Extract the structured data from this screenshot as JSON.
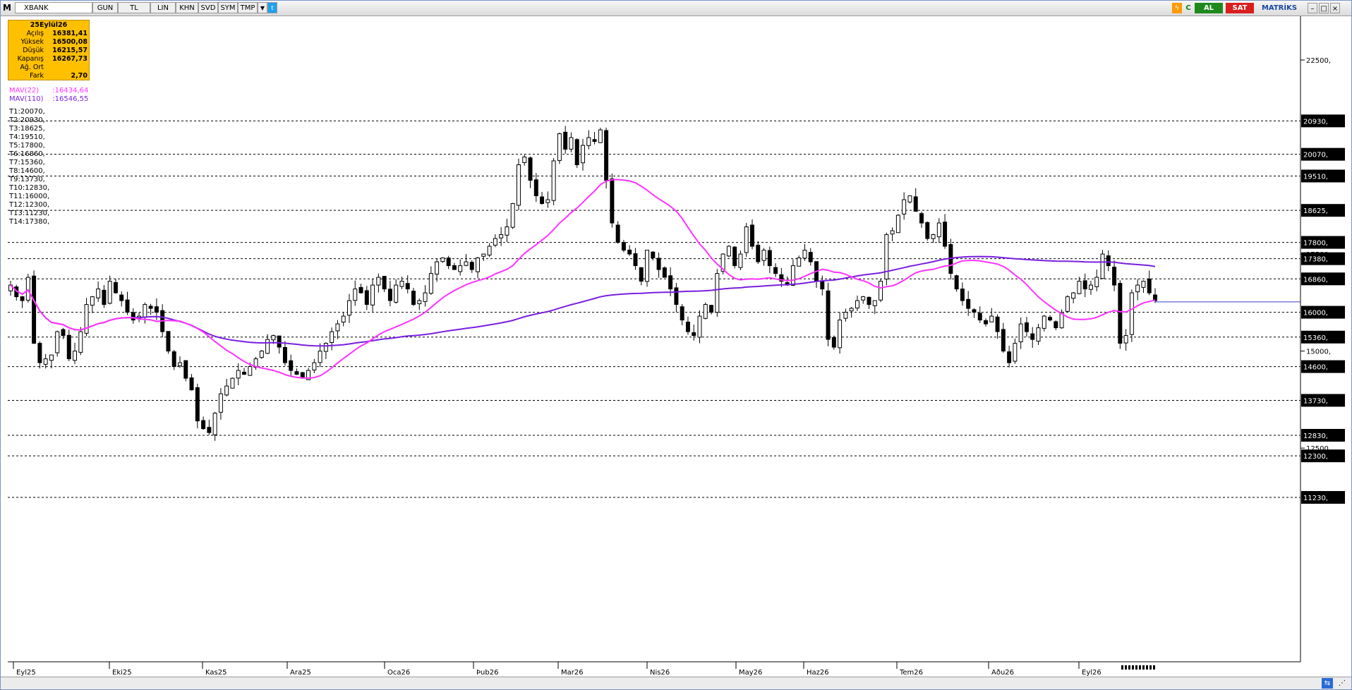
{
  "toolbar": {
    "symbol": "XBANK",
    "buttons": [
      "GUN",
      "TL",
      "LIN",
      "KHN",
      "SVD",
      "SYM",
      "TMP"
    ],
    "buy_label": "AL",
    "sell_label": "SAT",
    "brand": "MATRİKS"
  },
  "info_box": {
    "date": "25Eylül26",
    "rows": [
      {
        "label": "Açılış",
        "value": "16381,41"
      },
      {
        "label": "Yüksek",
        "value": "16500,08"
      },
      {
        "label": "Düşük",
        "value": "16215,57"
      },
      {
        "label": "Kapanış",
        "value": "16267,73"
      },
      {
        "label": "Ağ. Ort",
        "value": ""
      },
      {
        "label": "Fark",
        "value": "2,70"
      }
    ]
  },
  "legend": {
    "mav22": "MAV(22)      :16434,64",
    "mav110": "MAV(110)    :16546,55",
    "levels": [
      "T1:20070,",
      "T2:20930,",
      "T3:18625,",
      "T4:19510,",
      "T5:17800,",
      "T6:16860,",
      "T7:15360,",
      "T8:14600,",
      "T9:13730,",
      "T10:12830,",
      "T11:16000,",
      "T12:12300,",
      "T13:11230,",
      "T14:17380,"
    ]
  },
  "colors": {
    "mav22": "#ff33ff",
    "mav110": "#7a1fe0",
    "candle": "#000000",
    "level_label_bg": "#000000"
  },
  "chart_data": {
    "type": "candlestick",
    "symbol": "XBANK",
    "xlabels": [
      "Eyl25",
      "Eki25",
      "Kas25",
      "Ara25",
      "Oca26",
      "Þub26",
      "Mar26",
      "Nis26",
      "May26",
      "Haz26",
      "Tem26",
      "Aðu26",
      "Eyl26"
    ],
    "price_axis_ticks": [
      "22500,",
      "17500,",
      "15000,",
      "12500,"
    ],
    "levels": [
      20930,
      20070,
      19510,
      18625,
      17800,
      17380,
      16860,
      16000,
      15360,
      14600,
      13730,
      12830,
      12300,
      11230
    ],
    "level_labels": [
      "20930,",
      "20070,",
      "19510,",
      "18625,",
      "17800,",
      "17380,",
      "16860,",
      "16000,",
      "15360,",
      "14600,",
      "13730,",
      "12830,",
      "12300,",
      "11230,"
    ],
    "current_price": 16267.73,
    "ylim": [
      10000,
      23500
    ],
    "closes": [
      16700,
      16400,
      16300,
      16900,
      15200,
      14700,
      14800,
      14900,
      15500,
      15400,
      14800,
      15000,
      15500,
      16200,
      16400,
      16600,
      16200,
      16800,
      16500,
      16300,
      16000,
      15800,
      15900,
      16200,
      16100,
      16000,
      15500,
      15000,
      14600,
      14700,
      14300,
      14000,
      13200,
      13000,
      12900,
      13400,
      13900,
      14100,
      14300,
      14500,
      14400,
      14600,
      14800,
      15000,
      15300,
      15400,
      15100,
      14700,
      14500,
      14400,
      14300,
      14500,
      14700,
      15000,
      15200,
      15500,
      15700,
      15900,
      16300,
      16600,
      16500,
      16200,
      16700,
      16900,
      16600,
      16300,
      16700,
      16800,
      16600,
      16200,
      16300,
      16500,
      17000,
      17300,
      17400,
      17200,
      17100,
      17200,
      17300,
      17100,
      17400,
      17500,
      17700,
      17900,
      18000,
      18200,
      18800,
      19800,
      20000,
      19400,
      19000,
      18800,
      18900,
      19900,
      20600,
      20200,
      20500,
      19800,
      20300,
      20500,
      20400,
      20700,
      19400,
      18300,
      17800,
      17600,
      17500,
      17200,
      16800,
      17600,
      17400,
      17100,
      16900,
      16600,
      16200,
      15800,
      15500,
      15400,
      15900,
      16200,
      16000,
      17000,
      17500,
      17700,
      17200,
      17500,
      18200,
      17700,
      17300,
      17600,
      17200,
      17000,
      16800,
      16700,
      17200,
      17400,
      17600,
      17300,
      16800,
      16600,
      15300,
      15100,
      15800,
      16000,
      16100,
      16300,
      16400,
      16200,
      16300,
      16800,
      18000,
      18100,
      18500,
      18900,
      19000,
      18600,
      18300,
      17900,
      18000,
      18300,
      17700,
      17000,
      16600,
      16300,
      16100,
      16000,
      15800,
      15700,
      15900,
      15500,
      15000,
      14700,
      15200,
      15700,
      15500,
      15300,
      15600,
      15900,
      15800,
      15600,
      16000,
      16400,
      16500,
      16800,
      16600,
      16700,
      16900,
      17500,
      17200,
      16700,
      15200,
      15400,
      16500,
      16700,
      16800,
      16500,
      16300
    ]
  },
  "status": {
    "progress_dots": 10
  }
}
